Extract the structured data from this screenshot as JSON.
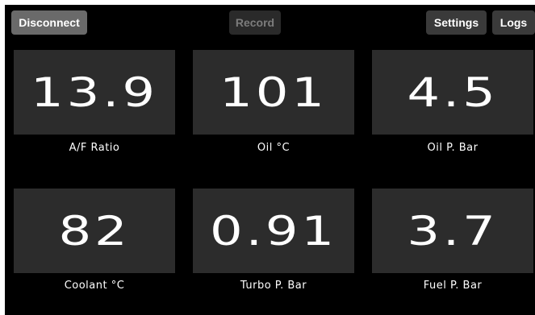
{
  "toolbar": {
    "disconnect_label": "Disconnect",
    "record_label": "Record",
    "settings_label": "Settings",
    "logs_label": "Logs"
  },
  "gauges": [
    {
      "value": "13.9",
      "label": "A/F Ratio"
    },
    {
      "value": "101",
      "label": "Oil °C"
    },
    {
      "value": "4.5",
      "label": "Oil P. Bar"
    },
    {
      "value": "82",
      "label": "Coolant °C"
    },
    {
      "value": "0.91",
      "label": "Turbo P. Bar"
    },
    {
      "value": "3.7",
      "label": "Fuel P. Bar"
    }
  ],
  "colors": {
    "background": "#000000",
    "tile": "#2c2c2c",
    "text": "#ffffff",
    "disabled_text": "#7c7c7c"
  }
}
